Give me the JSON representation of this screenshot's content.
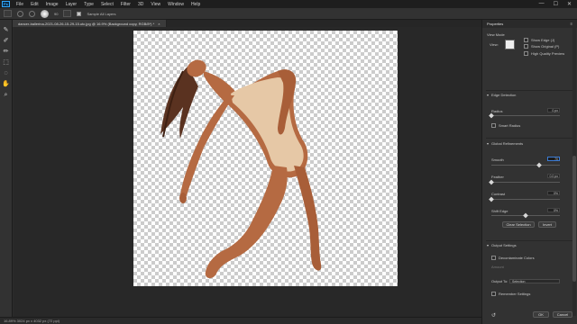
{
  "menubar": {
    "logo": "Ps",
    "items": [
      "File",
      "Edit",
      "Image",
      "Layer",
      "Type",
      "Select",
      "Filter",
      "3D",
      "View",
      "Window",
      "Help"
    ],
    "win": [
      "—",
      "☐",
      "✕"
    ]
  },
  "options": {
    "size": "90",
    "sample_label": "Sample All Layers"
  },
  "document": {
    "tab_title": "dancer-ballerina-2021-08-26-15-29-15.utc.jpg @ 16.9% (Background copy, RGB/8*) *",
    "close": "×"
  },
  "status": {
    "text": "16.89%    3024 px x 4032 px (72 ppi)"
  },
  "properties": {
    "title": "Properties",
    "view_mode_label": "View Mode",
    "view_label": "View:",
    "show_edge": "Show Edge (J)",
    "show_original": "Show Original (P)",
    "hq_preview": "High Quality Preview",
    "edge_detection": "Edge Detection",
    "radius_label": "Radius",
    "radius_value": "0 px",
    "smart_radius": "Smart Radius",
    "global_refinements": "Global Refinements",
    "smooth_label": "Smooth",
    "smooth_value": "70",
    "feather_label": "Feather",
    "feather_value": "0.0 px",
    "contrast_label": "Contrast",
    "contrast_value": "0%",
    "shift_edge_label": "Shift Edge",
    "shift_edge_value": "0%",
    "clear_selection": "Clear Selection",
    "invert": "Invert",
    "output_settings": "Output Settings",
    "decontaminate": "Decontaminate Colors",
    "amount_label": "Amount",
    "output_to_label": "Output To:",
    "output_to_value": "Selection",
    "remember_settings": "Remember Settings",
    "ok": "OK",
    "cancel": "Cancel",
    "levels": {
      "radius": 0.0,
      "smooth": 0.7,
      "feather": 0.0,
      "contrast": 0.0,
      "shift_edge": 0.5
    }
  },
  "colors": {
    "accent": "#31a8ff",
    "skin": "#b56a42",
    "leotard": "#e6c8a6",
    "hair": "#5a3220"
  }
}
